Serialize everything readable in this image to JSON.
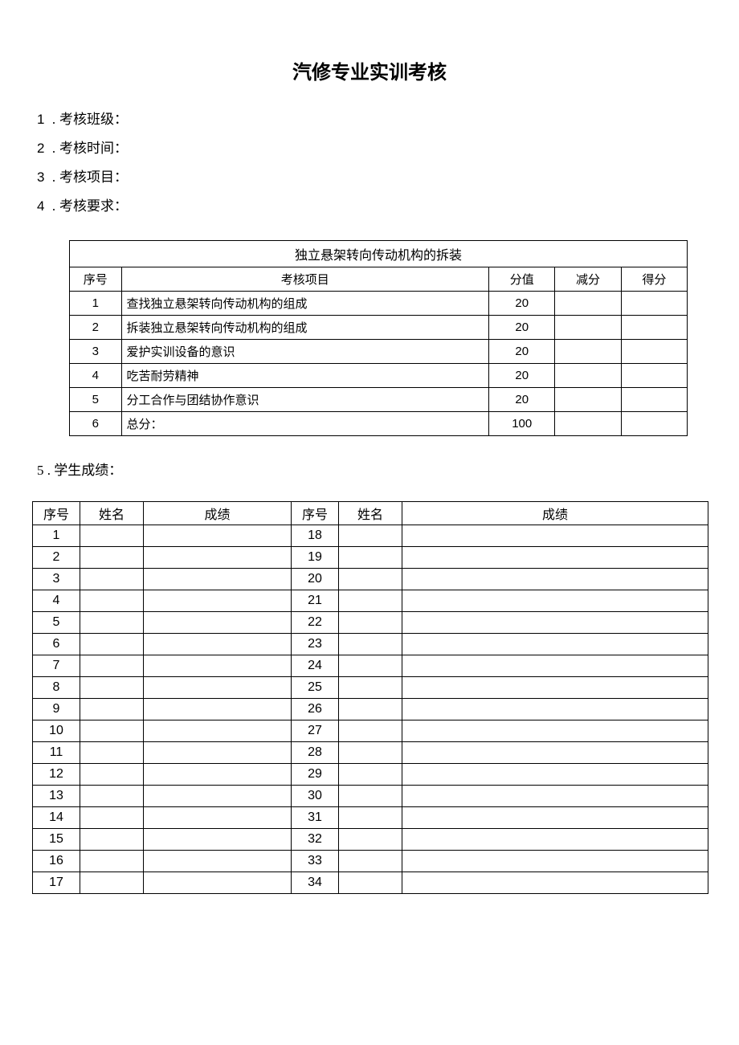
{
  "title": "汽修专业实训考核",
  "meta": [
    {
      "num": "1",
      "label": "考核班级："
    },
    {
      "num": "2",
      "label": "考核时间："
    },
    {
      "num": "3",
      "label": "考核项目："
    },
    {
      "num": "4",
      "label": "考核要求："
    }
  ],
  "rubric": {
    "caption": "独立悬架转向传动机构的拆装",
    "headers": {
      "seq": "序号",
      "item": "考核项目",
      "score": "分值",
      "deduct": "减分",
      "final": "得分"
    },
    "rows": [
      {
        "seq": "1",
        "item": "查找独立悬架转向传动机构的组成",
        "score": "20",
        "deduct": "",
        "final": ""
      },
      {
        "seq": "2",
        "item": "拆装独立悬架转向传动机构的组成",
        "score": "20",
        "deduct": "",
        "final": ""
      },
      {
        "seq": "3",
        "item": "爱护实训设备的意识",
        "score": "20",
        "deduct": "",
        "final": ""
      },
      {
        "seq": "4",
        "item": "吃苦耐劳精神",
        "score": "20",
        "deduct": "",
        "final": ""
      },
      {
        "seq": "5",
        "item": "分工合作与团结协作意识",
        "score": "20",
        "deduct": "",
        "final": ""
      },
      {
        "seq": "6",
        "item": "总分：",
        "score": "100",
        "deduct": "",
        "final": ""
      }
    ]
  },
  "section5": {
    "num": "5",
    "label": "学生成绩："
  },
  "grades": {
    "headers": {
      "seq": "序号",
      "name": "姓名",
      "grade": "成绩"
    },
    "rows": [
      {
        "l": "1",
        "r": "18"
      },
      {
        "l": "2",
        "r": "19"
      },
      {
        "l": "3",
        "r": "20"
      },
      {
        "l": "4",
        "r": "21"
      },
      {
        "l": "5",
        "r": "22"
      },
      {
        "l": "6",
        "r": "23"
      },
      {
        "l": "7",
        "r": "24"
      },
      {
        "l": "8",
        "r": "25"
      },
      {
        "l": "9",
        "r": "26"
      },
      {
        "l": "10",
        "r": "27"
      },
      {
        "l": "11",
        "r": "28"
      },
      {
        "l": "12",
        "r": "29"
      },
      {
        "l": "13",
        "r": "30"
      },
      {
        "l": "14",
        "r": "31"
      },
      {
        "l": "15",
        "r": "32"
      },
      {
        "l": "16",
        "r": "33"
      },
      {
        "l": "17",
        "r": "34"
      }
    ]
  }
}
